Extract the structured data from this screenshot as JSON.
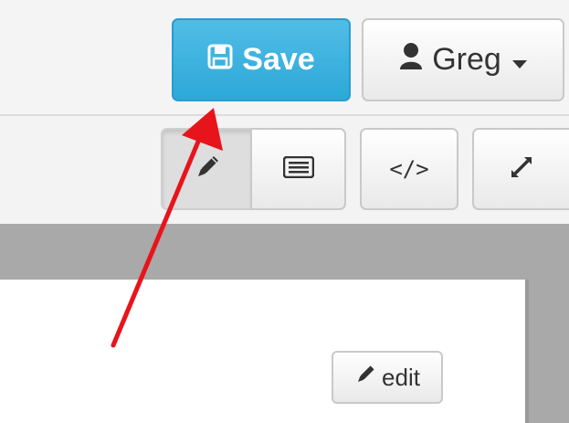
{
  "header": {
    "save_button": {
      "label": "Save",
      "icon": "floppy-disk-icon",
      "color": "#39b3d7"
    },
    "user_menu": {
      "label": "Greg",
      "icon": "user-icon",
      "caret": "chevron-down-icon"
    }
  },
  "toolbar": {
    "buttons": [
      {
        "name": "edit-mode",
        "icon": "pencil-icon",
        "active": true
      },
      {
        "name": "preview-mode",
        "icon": "list-icon",
        "active": false
      },
      {
        "name": "source-mode",
        "icon": "code-icon",
        "glyph": "</>",
        "active": false
      },
      {
        "name": "fullscreen",
        "icon": "expand-icon",
        "active": false
      }
    ]
  },
  "content": {
    "edit_button": {
      "label": "edit",
      "icon": "pencil-icon"
    }
  },
  "annotation": {
    "arrow_color": "#e8141b",
    "points_to": "save-button"
  }
}
